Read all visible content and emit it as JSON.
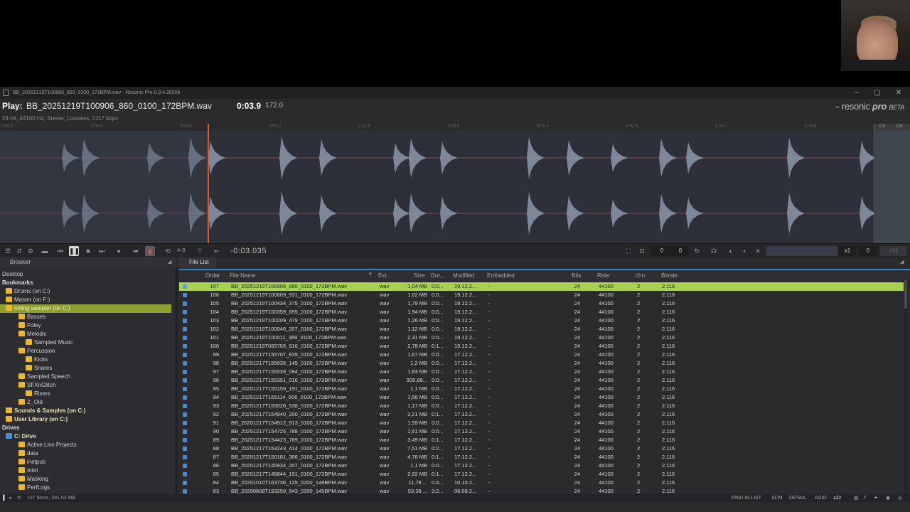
{
  "window": {
    "title": "BB_20251219T100906_860_0100_172BPM.wav - Resonic Pro 0.9.4.2020b",
    "minimize": "–",
    "maximize": "▢",
    "close": "✕"
  },
  "player": {
    "play_label": "Play:",
    "file": "BB_20251219T100906_860_0100_172BPM.wav",
    "time": "0:03.9",
    "bpm": "172.0",
    "info": "24-bit, 44100 Hz, Stereo, Lossless, 2117 kbps",
    "logo_a": "resonic",
    "logo_b": "pro",
    "logo_c": "BETA",
    "position": "-0:03.035",
    "playhead_fraction": 0.237,
    "ruler_ticks": [
      "0:00.0",
      "0:00.4",
      "0:00.8",
      "0:01.2",
      "0:01.6",
      "0:02.0",
      "0:02.4",
      "0:02.8",
      "0:03.2",
      "0:03.6"
    ],
    "ruler_right_a": "0:0",
    "ruler_right_b": "0:0"
  },
  "transport": {
    "box1": "0",
    "box2": "0",
    "speed": "x1",
    "pitch": "0"
  },
  "panels": {
    "browser_tab": "Browser",
    "filelist_tab": "File List"
  },
  "sidebar": {
    "items": [
      {
        "label": "Desktop",
        "type": "plain"
      },
      {
        "label": "Bookmarks",
        "type": "header"
      },
      {
        "label": "Drums (on C:)",
        "type": "folder"
      },
      {
        "label": "Master (on F:)",
        "type": "folder"
      },
      {
        "label": "rolling sampler (on C:)",
        "type": "folder",
        "selected": true
      },
      {
        "label": "Basses",
        "type": "folder"
      },
      {
        "label": "Foley",
        "type": "folder"
      },
      {
        "label": "Melodic",
        "type": "folder"
      },
      {
        "label": "Sampled Music",
        "type": "folder"
      },
      {
        "label": "Percussion",
        "type": "folder"
      },
      {
        "label": "Kicks",
        "type": "folder"
      },
      {
        "label": "Snares",
        "type": "folder"
      },
      {
        "label": "Sampled Speech",
        "type": "folder"
      },
      {
        "label": "SFXnGlitch",
        "type": "folder"
      },
      {
        "label": "Risers",
        "type": "folder"
      },
      {
        "label": "Z_Old",
        "type": "folder"
      },
      {
        "label": "Sounds & Samples (on C:)",
        "type": "folder",
        "bold": true
      },
      {
        "label": "User Library (on C:)",
        "type": "folder",
        "bold": true
      },
      {
        "label": "Drives",
        "type": "header"
      },
      {
        "label": "C: Drive",
        "type": "drive",
        "bold": true
      },
      {
        "label": "Active Live Projects",
        "type": "folder"
      },
      {
        "label": "data",
        "type": "folder"
      },
      {
        "label": "inetpub",
        "type": "folder"
      },
      {
        "label": "Intel",
        "type": "folder"
      },
      {
        "label": "Masking",
        "type": "folder"
      },
      {
        "label": "PerfLogs",
        "type": "folder"
      }
    ]
  },
  "list": {
    "columns": [
      "Order",
      "File Name",
      "Ext.",
      "Size",
      "Dur...",
      "Modified",
      "Embedded",
      "Bits",
      "Rate",
      "chn.",
      "Bitrate"
    ],
    "rows": [
      [
        "107",
        "BB_20251219T100906_860_0100_172BPM.wav",
        "wav",
        "1,04 MB",
        "0:0...",
        "19.12.2...",
        "-",
        "24",
        "44100",
        "2",
        "2.116"
      ],
      [
        "106",
        "BB_20251219T100609_931_0100_172BPM.wav",
        "wav",
        "1,62 MB",
        "0:0...",
        "19.12.2...",
        "-",
        "24",
        "44100",
        "2",
        "2.116"
      ],
      [
        "105",
        "BB_20251219T100434_375_0100_172BPM.wav",
        "wav",
        "1,79 MB",
        "0:0...",
        "19.12.2...",
        "-",
        "24",
        "44100",
        "2",
        "2.116"
      ],
      [
        "104",
        "BB_20251219T100359_655_0100_172BPM.wav",
        "wav",
        "1,94 MB",
        "0:0...",
        "19.12.2...",
        "-",
        "24",
        "44100",
        "2",
        "2.116"
      ],
      [
        "103",
        "BB_20251219T100209_479_0100_172BPM.wav",
        "wav",
        "1,26 MB",
        "0:0...",
        "19.12.2...",
        "-",
        "24",
        "44100",
        "2",
        "2.116"
      ],
      [
        "102",
        "BB_20251219T100046_207_0100_172BPM.wav",
        "wav",
        "1,12 MB",
        "0:0...",
        "19.12.2...",
        "-",
        "24",
        "44100",
        "2",
        "2.116"
      ],
      [
        "101",
        "BB_20251219T100011_389_0100_172BPM.wav",
        "wav",
        "2,31 MB",
        "0:0...",
        "19.12.2...",
        "-",
        "24",
        "44100",
        "2",
        "2.116"
      ],
      [
        "100",
        "BB_20251219T095755_916_0100_172BPM.wav",
        "wav",
        "2,78 MB",
        "0:1...",
        "19.12.2...",
        "-",
        "24",
        "44100",
        "2",
        "2.116"
      ],
      [
        "99",
        "BB_20251217T155707_835_0100_172BPM.wav",
        "wav",
        "1,67 MB",
        "0:0...",
        "17.12.2...",
        "-",
        "24",
        "44100",
        "2",
        "2.116"
      ],
      [
        "98",
        "BB_20251217T155636_145_0100_172BPM.wav",
        "wav",
        "1,2 MB",
        "0:0...",
        "17.12.2...",
        "-",
        "24",
        "44100",
        "2",
        "2.116"
      ],
      [
        "97",
        "BB_20251217T155539_094_0100_172BPM.wav",
        "wav",
        "1,83 MB",
        "0:0...",
        "17.12.2...",
        "-",
        "24",
        "44100",
        "2",
        "2.116"
      ],
      [
        "96",
        "BB_20251217T155351_016_0100_172BPM.wav",
        "wav",
        "905,88...",
        "0:0...",
        "17.12.2...",
        "-",
        "24",
        "44100",
        "2",
        "2.116"
      ],
      [
        "95",
        "BB_20251217T155159_191_0100_172BPM.wav",
        "wav",
        "1,1 MB",
        "0:0...",
        "17.12.2...",
        "-",
        "24",
        "44100",
        "2",
        "2.116"
      ],
      [
        "94",
        "BB_20251217T155114_506_0100_172BPM.wav",
        "wav",
        "1,56 MB",
        "0:0...",
        "17.12.2...",
        "-",
        "24",
        "44100",
        "2",
        "2.116"
      ],
      [
        "93",
        "BB_20251217T155026_538_0100_172BPM.wav",
        "wav",
        "1,17 MB",
        "0:0...",
        "17.12.2...",
        "-",
        "24",
        "44100",
        "2",
        "2.116"
      ],
      [
        "92",
        "BB_20251217T154940_200_0100_172BPM.wav",
        "wav",
        "3,21 MB",
        "0:1...",
        "17.12.2...",
        "-",
        "24",
        "44100",
        "2",
        "2.116"
      ],
      [
        "91",
        "BB_20251217T154912_913_0100_172BPM.wav",
        "wav",
        "1,59 MB",
        "0:0...",
        "17.12.2...",
        "-",
        "24",
        "44100",
        "2",
        "2.116"
      ],
      [
        "90",
        "BB_20251217T154725_788_0100_172BPM.wav",
        "wav",
        "1,61 MB",
        "0:0...",
        "17.12.2...",
        "-",
        "24",
        "44100",
        "2",
        "2.116"
      ],
      [
        "89",
        "BB_20251217T154423_769_0100_172BPM.wav",
        "wav",
        "3,49 MB",
        "0:1...",
        "17.12.2...",
        "-",
        "24",
        "44100",
        "2",
        "2.116"
      ],
      [
        "88",
        "BB_20251217T153243_414_0100_172BPM.wav",
        "wav",
        "7,51 MB",
        "0:2...",
        "17.12.2...",
        "-",
        "24",
        "44100",
        "2",
        "2.116"
      ],
      [
        "87",
        "BB_20251217T150101_306_0100_172BPM.wav",
        "wav",
        "4,78 MB",
        "0:1...",
        "17.12.2...",
        "-",
        "24",
        "44100",
        "2",
        "2.116"
      ],
      [
        "86",
        "BB_20251217T145934_207_0100_172BPM.wav",
        "wav",
        "1,1 MB",
        "0:0...",
        "17.12.2...",
        "-",
        "24",
        "44100",
        "2",
        "2.116"
      ],
      [
        "85",
        "BB_20251217T145844_191_0100_172BPM.wav",
        "wav",
        "2,92 MB",
        "0:1...",
        "17.12.2...",
        "-",
        "24",
        "44100",
        "2",
        "2.116"
      ],
      [
        "84",
        "BB_20251010T163736_125_0200_148BPM.wav",
        "wav",
        "11,78 ...",
        "0:4...",
        "10.10.2...",
        "-",
        "24",
        "44100",
        "2",
        "2.116"
      ],
      [
        "83",
        "BB_20250808T193250_543_0200_145BPM.wav",
        "wav",
        "53,38 ...",
        "3:2...",
        "08.08.2...",
        "-",
        "24",
        "44100",
        "2",
        "2.116"
      ]
    ]
  },
  "status": {
    "summary": "107 items, 391,52 MB",
    "find": "FIND IN LIST",
    "scm": "SCM",
    "detail": "DETAIL",
    "asio": "ASIO"
  },
  "colors": {
    "accent": "#3a82c8",
    "selection": "#a6d153",
    "playhead": "#e05a2a",
    "folder": "#e8b830"
  }
}
